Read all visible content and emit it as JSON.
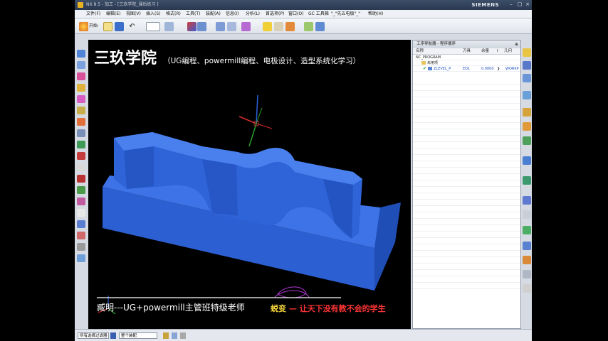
{
  "titlebar": {
    "title": "NX 8.5 - 加工 - [三玖学院_课后练习 ]",
    "brand": "SIEMENS"
  },
  "menu": [
    "文件(F)",
    "编辑(E)",
    "视图(V)",
    "插入(S)",
    "格式(R)",
    "工具(T)",
    "装配(A)",
    "信息(I)",
    "分析(L)",
    "首选项(P)",
    "窗口(O)",
    "GC 工具箱",
    "\"_\"先五电极\"_\"",
    "帮助(H)"
  ],
  "toolbar": {
    "start_label": "开始·"
  },
  "banner": {
    "title": "三玖学院",
    "subtitle": "（UG编程、powermill编程、电极设计、造型系统化学习）"
  },
  "footer": {
    "teacher": "臧明---UG+powermill主管班特级老师",
    "slogan_a": "蜕变",
    "slogan_b": "— 让天下没有教不会的学生"
  },
  "navigator": {
    "title": "工序导航器 - 程序顺序",
    "columns": [
      "名称",
      "刀具",
      "余量",
      "I",
      "几何"
    ],
    "rows": [
      {
        "name": "NC_PROGRAM",
        "tool": "",
        "stock": "",
        "geom": ""
      },
      {
        "name": "未用项",
        "tool": "",
        "stock": "",
        "geom": ""
      },
      {
        "name": "ZLEVEL_P",
        "tool": "ED1",
        "stock": "0.0000",
        "geom": "WORKP"
      }
    ]
  },
  "statusbar": {
    "filter": "所有选择过滤器",
    "scope": "整个装配"
  },
  "colors": {
    "part": "#2f64d8",
    "axis_z": "#2b5fd6",
    "axis_x": "#d92b2b",
    "axis_y": "#2aa02a",
    "slogan": "#f2d23a",
    "slogan_red": "#ff3535"
  }
}
